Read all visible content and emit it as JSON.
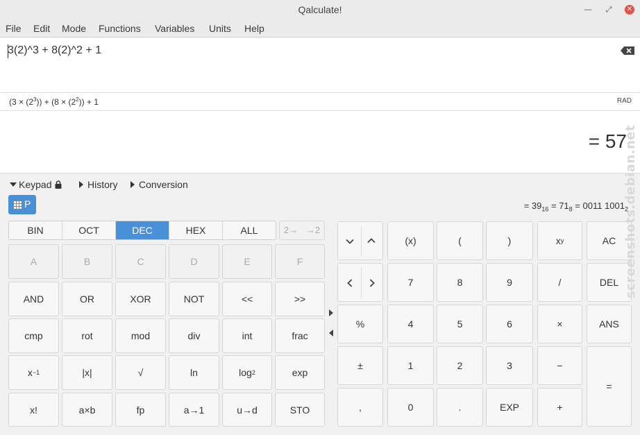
{
  "window": {
    "title": "Qalculate!",
    "minimize_glyph": "—",
    "restore_glyph": "⤢",
    "close_glyph": "✕"
  },
  "menu": [
    "File",
    "Edit",
    "Mode",
    "Functions",
    "Variables",
    "Units",
    "Help"
  ],
  "entry": {
    "expression": "3(2)^3 + 8(2)^2 + 1"
  },
  "parsed": {
    "a": "(3 × (2",
    "a_exp": "3",
    "b": ")) + (8 × (2",
    "b_exp": "2",
    "c": ")) + 1",
    "angle_mode": "RAD"
  },
  "result": {
    "text": "= 57"
  },
  "expanders": {
    "keypad": "Keypad",
    "history": "History",
    "conversion": "Conversion"
  },
  "programmer": {
    "button_label": "P"
  },
  "conversion_line": {
    "hex": "= 39",
    "hex_base": "16",
    "oct": " = 71",
    "oct_base": "8",
    "bin": " = 0011 1001",
    "bin_base": "2"
  },
  "bases": [
    "BIN",
    "OCT",
    "DEC",
    "HEX",
    "ALL"
  ],
  "active_base": "DEC",
  "bit_buttons": [
    "2→",
    "→2"
  ],
  "hex_digits": [
    "A",
    "B",
    "C",
    "D",
    "E",
    "F"
  ],
  "prog_keys_row2": [
    "AND",
    "OR",
    "XOR",
    "NOT",
    "<<",
    ">>"
  ],
  "prog_keys_row3": [
    "cmp",
    "rot",
    "mod",
    "div",
    "int",
    "frac"
  ],
  "prog_keys_row4": {
    "inv": "x",
    "inv_exp": "−1",
    "abs": "|x|",
    "sqrt": "√",
    "ln": "ln",
    "log": "log",
    "log_sub": "2",
    "exp": "exp"
  },
  "prog_keys_row5": [
    "x!",
    "a×b",
    "fp",
    "a→1",
    "u→d",
    "STO"
  ],
  "num_col_left": {
    "percent": "%",
    "plusminus": "±",
    "comma": ","
  },
  "numpad": {
    "row1": [
      "(x)",
      "(",
      ")"
    ],
    "pow": "x",
    "pow_exp": "y",
    "ac": "AC",
    "row2": [
      "7",
      "8",
      "9",
      "/",
      "DEL"
    ],
    "row3": [
      "4",
      "5",
      "6",
      "×",
      "ANS"
    ],
    "row4": [
      "1",
      "2",
      "3",
      "−"
    ],
    "row5": [
      "0",
      ".",
      "EXP",
      "+"
    ],
    "equals": "="
  },
  "watermark": "screenshots.debian.net"
}
